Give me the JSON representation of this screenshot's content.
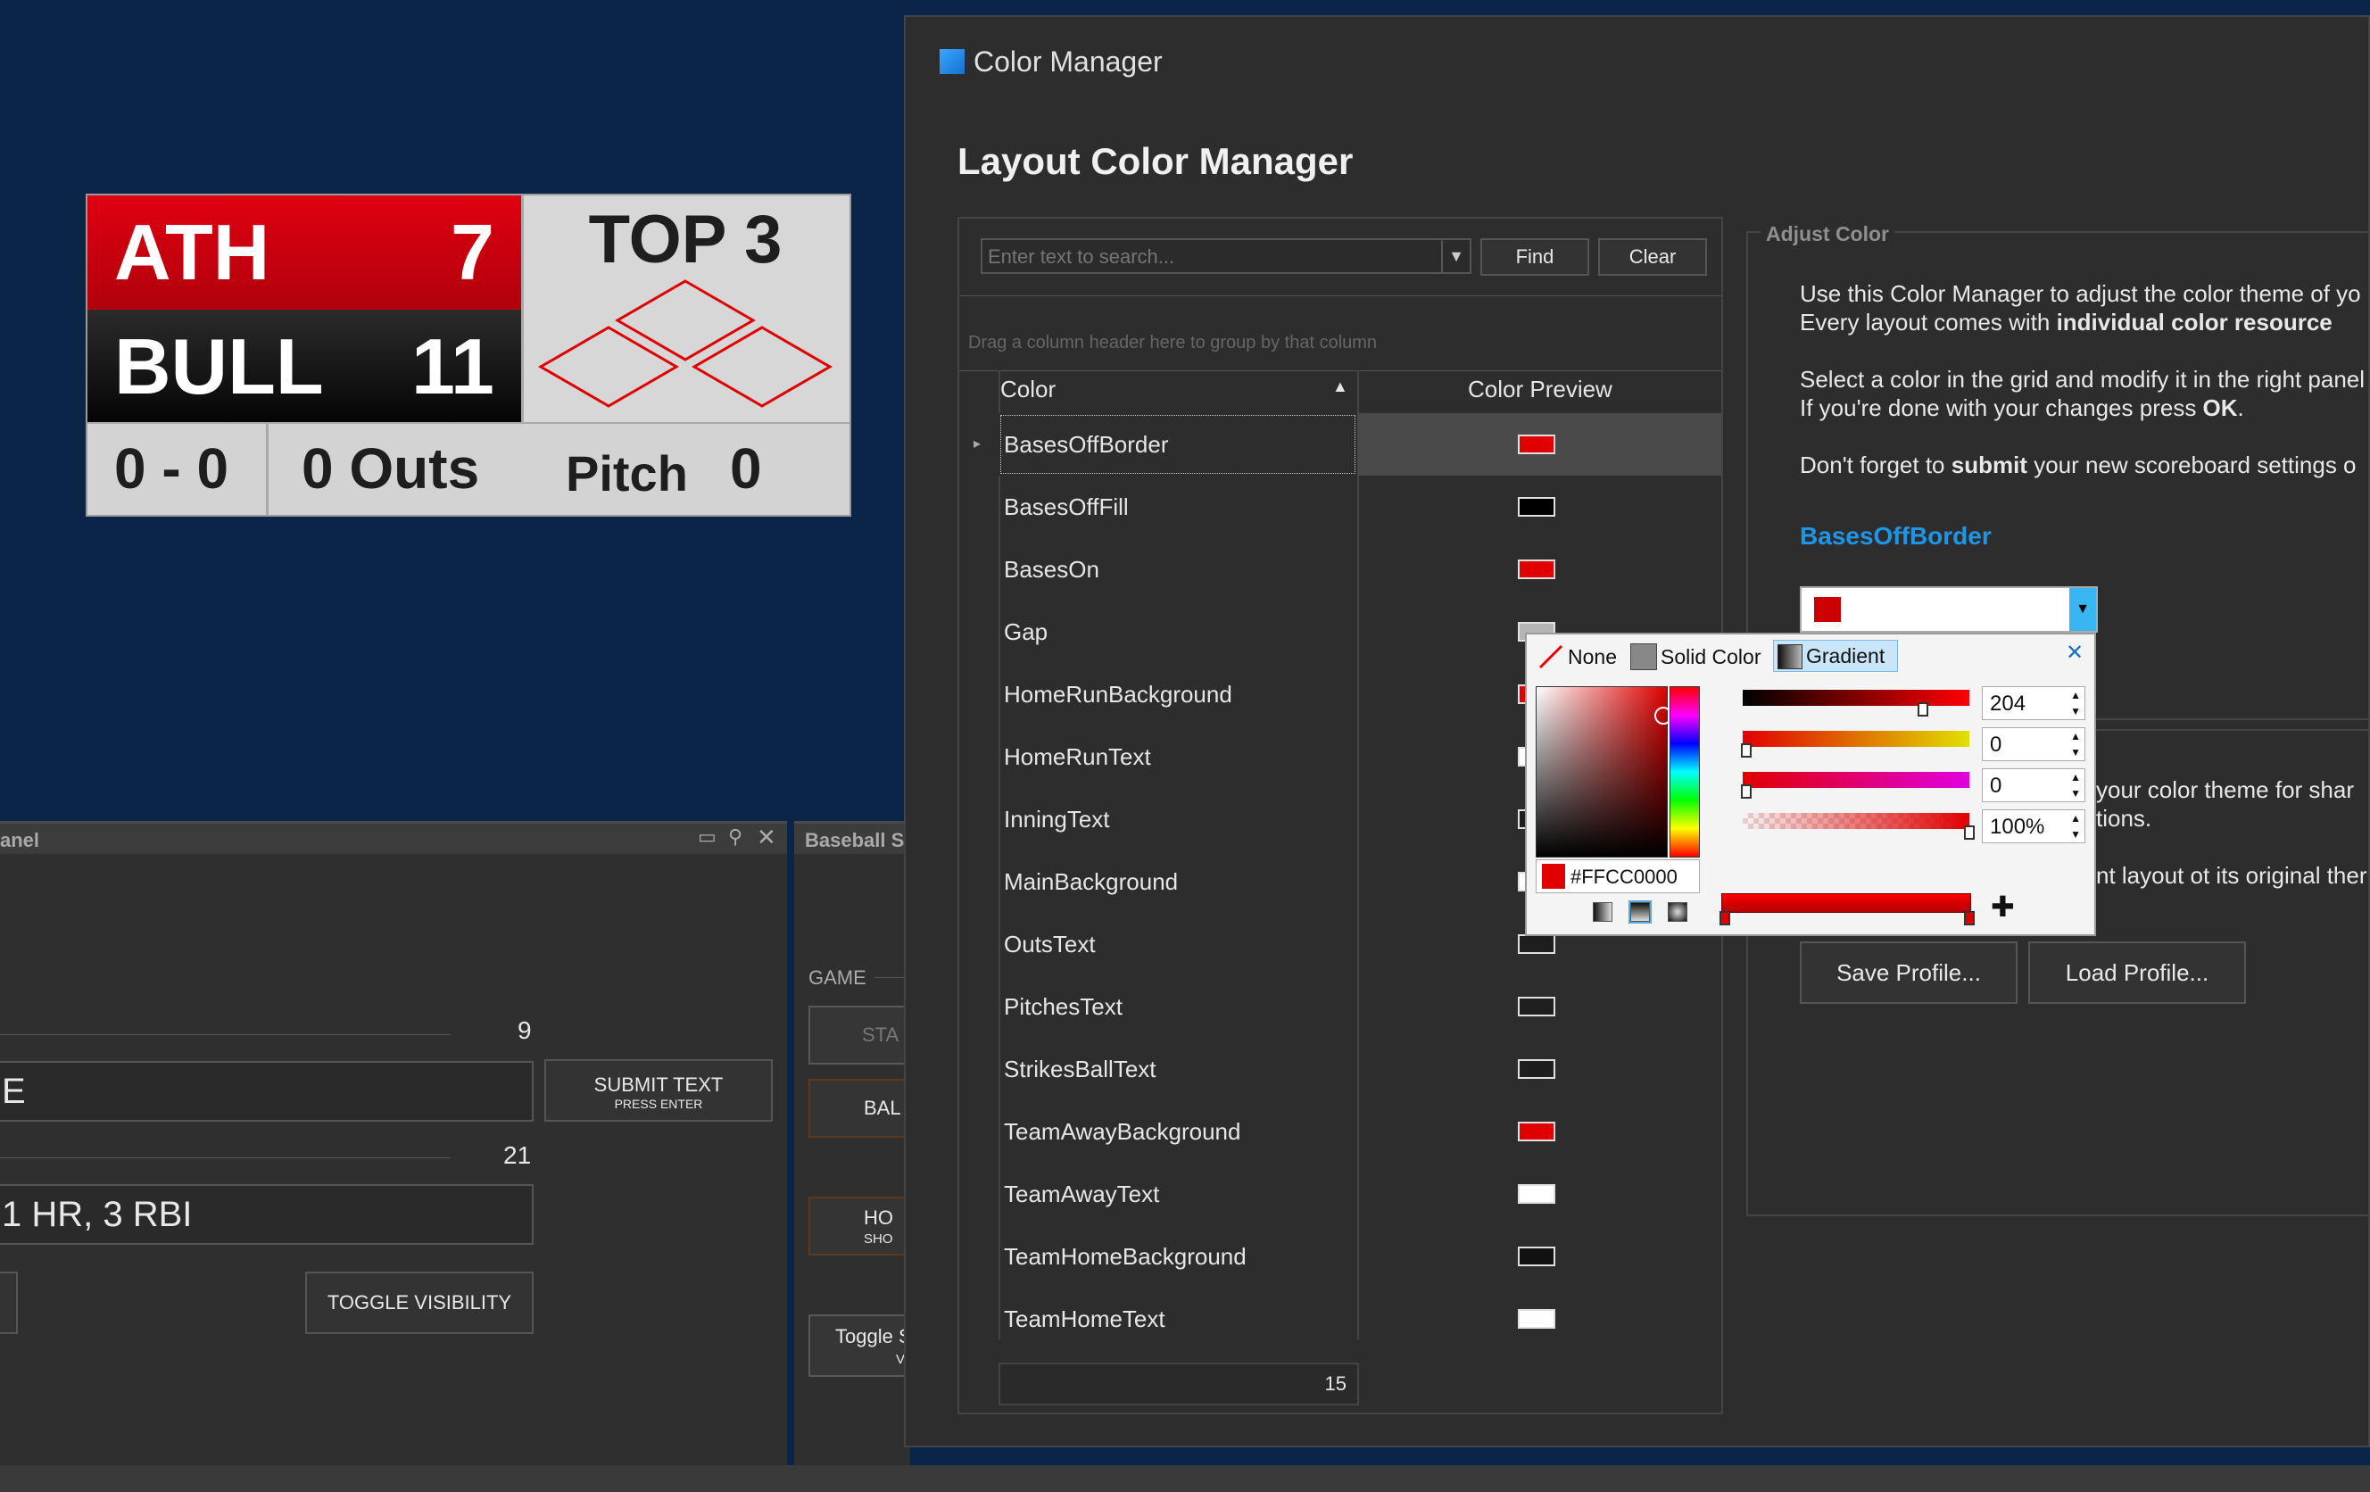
{
  "scoreboard": {
    "away_team": "ATH",
    "away_score": "7",
    "home_team": "BULL",
    "home_score": "11",
    "inning": "TOP 3",
    "count": "0 - 0",
    "outs": "0 Outs",
    "pitch_label": "Pitch",
    "pitch_value": "0"
  },
  "left_panel": {
    "title": "anel",
    "field1_counter": "9",
    "field1_value": "E",
    "submit_button": "SUBMIT TEXT",
    "submit_sub": "PRESS ENTER",
    "field2_counter": "21",
    "field2_value": "1 HR, 3 RBI",
    "toggle_button": "TOGGLE VISIBILITY"
  },
  "mid_panel": {
    "title": "Baseball S",
    "group_label": "GAME",
    "btn1": "STA",
    "btn2": "BAL",
    "btn3_line1": "HO",
    "btn3_line2": "SHO",
    "btn4_line1": "Toggle S",
    "btn4_line2": "V"
  },
  "window": {
    "title": "Color Manager",
    "heading": "Layout Color Manager"
  },
  "search": {
    "placeholder": "Enter text to search...",
    "find_button": "Find",
    "clear_button": "Clear"
  },
  "grid": {
    "group_hint": "Drag a column header here to group by that column",
    "col_color": "Color",
    "col_preview": "Color Preview",
    "rows": [
      {
        "name": "BasesOffBorder",
        "color": "#e00000"
      },
      {
        "name": "BasesOffFill",
        "color": "#000000"
      },
      {
        "name": "BasesOn",
        "color": "#e00000"
      },
      {
        "name": "Gap",
        "color": "#b4b4b4"
      },
      {
        "name": "HomeRunBackground",
        "color": "#e00000"
      },
      {
        "name": "HomeRunText",
        "color": "#ffffff"
      },
      {
        "name": "InningText",
        "color": "#1e1e1e"
      },
      {
        "name": "MainBackground",
        "color": "#ffffff"
      },
      {
        "name": "OutsText",
        "color": "#1e1e1e"
      },
      {
        "name": "PitchesText",
        "color": "#1e1e1e"
      },
      {
        "name": "StrikesBallText",
        "color": "#1e1e1e"
      },
      {
        "name": "TeamAwayBackground",
        "color": "#e00000"
      },
      {
        "name": "TeamAwayText",
        "color": "#ffffff"
      },
      {
        "name": "TeamHomeBackground",
        "color": "#111111"
      },
      {
        "name": "TeamHomeText",
        "color": "#ffffff"
      }
    ],
    "count": "15"
  },
  "adjust": {
    "group_title": "Adjust Color",
    "line1": "Use this Color Manager to adjust the color theme of yo",
    "line2_pre": "Every layout comes with ",
    "line2_bold": "individual color resource",
    "line3": "Select a color in the grid and modify it in the right panel",
    "line4_pre": "If you're done with your changes press ",
    "line4_bold": "OK",
    "line4_post": ".",
    "line5_pre": "Don't forget to ",
    "line5_bold": "submit",
    "line5_post": " your new scoreboard settings o",
    "selected_name": "BasesOffBorder",
    "selected_color": "#cc0000"
  },
  "profile": {
    "text1": "your color theme for shar",
    "text2": "tions.",
    "text3": "nt layout ot its original ther",
    "save_button": "Save Profile...",
    "load_button": "Load Profile..."
  },
  "picker": {
    "tab_none": "None",
    "tab_solid": "Solid Color",
    "tab_gradient": "Gradient",
    "red_value": "204",
    "green_value": "0",
    "blue_value": "0",
    "alpha_value": "100%",
    "hex_value": "#FFCC0000"
  }
}
